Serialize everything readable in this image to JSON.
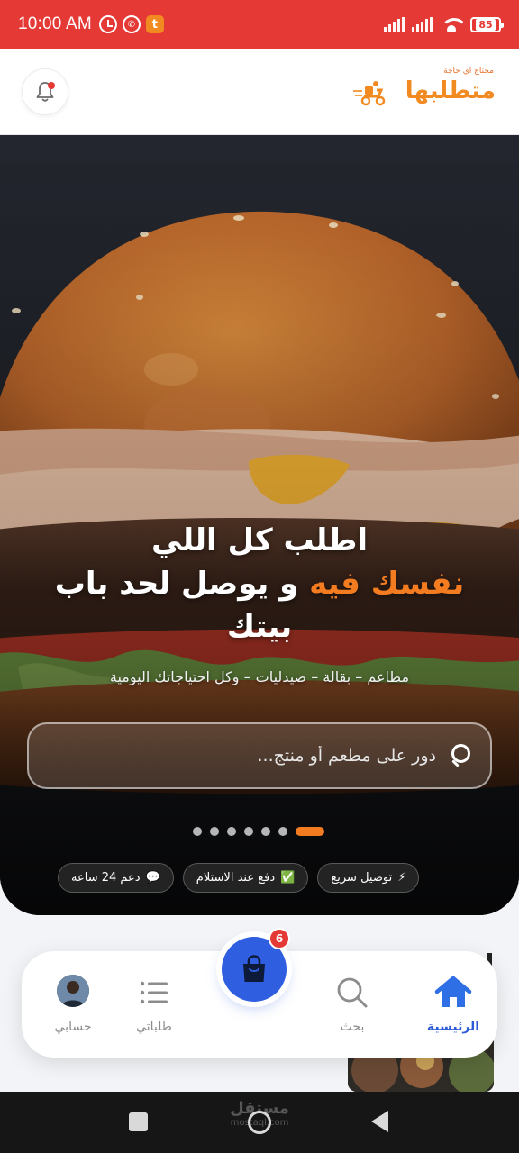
{
  "status_bar": {
    "time": "10:00 AM",
    "battery": "85",
    "icons": [
      "alarm-icon",
      "whatsapp-icon",
      "t-app-icon",
      "signal-icon",
      "signal-icon",
      "wifi-icon",
      "battery-icon"
    ]
  },
  "header": {
    "logo_text": "متطلبها",
    "logo_tagline": "محتاج اي حاجة",
    "notification_icon": "bell-icon"
  },
  "hero": {
    "title_line1": "اطلب كل اللي",
    "title_accent": "نفسك فيه",
    "title_rest": " و يوصل لحد باب بيتك",
    "subtitle": "مطاعم – بقالة – صيدليات – وكل احتياجاتك اليومية",
    "search_placeholder": "دور على مطعم أو منتج...",
    "slide_count": 7,
    "active_slide": 0,
    "features": [
      {
        "icon": "⚡",
        "label": "توصيل سريع"
      },
      {
        "icon": "✅",
        "label": "دفع عند الاستلام"
      },
      {
        "icon": "💬",
        "label": "دعم 24 ساعه"
      }
    ]
  },
  "bottom_nav": {
    "home": "الرئيسية",
    "search": "بحث",
    "orders": "طلباتي",
    "account": "حسابي",
    "cart_count": "6"
  },
  "colors": {
    "accent_orange": "#f47c20",
    "brand_blue": "#2f5fe0",
    "status_red": "#e53935"
  },
  "watermark": {
    "arabic": "مستقل",
    "latin": "mostaql.com"
  }
}
